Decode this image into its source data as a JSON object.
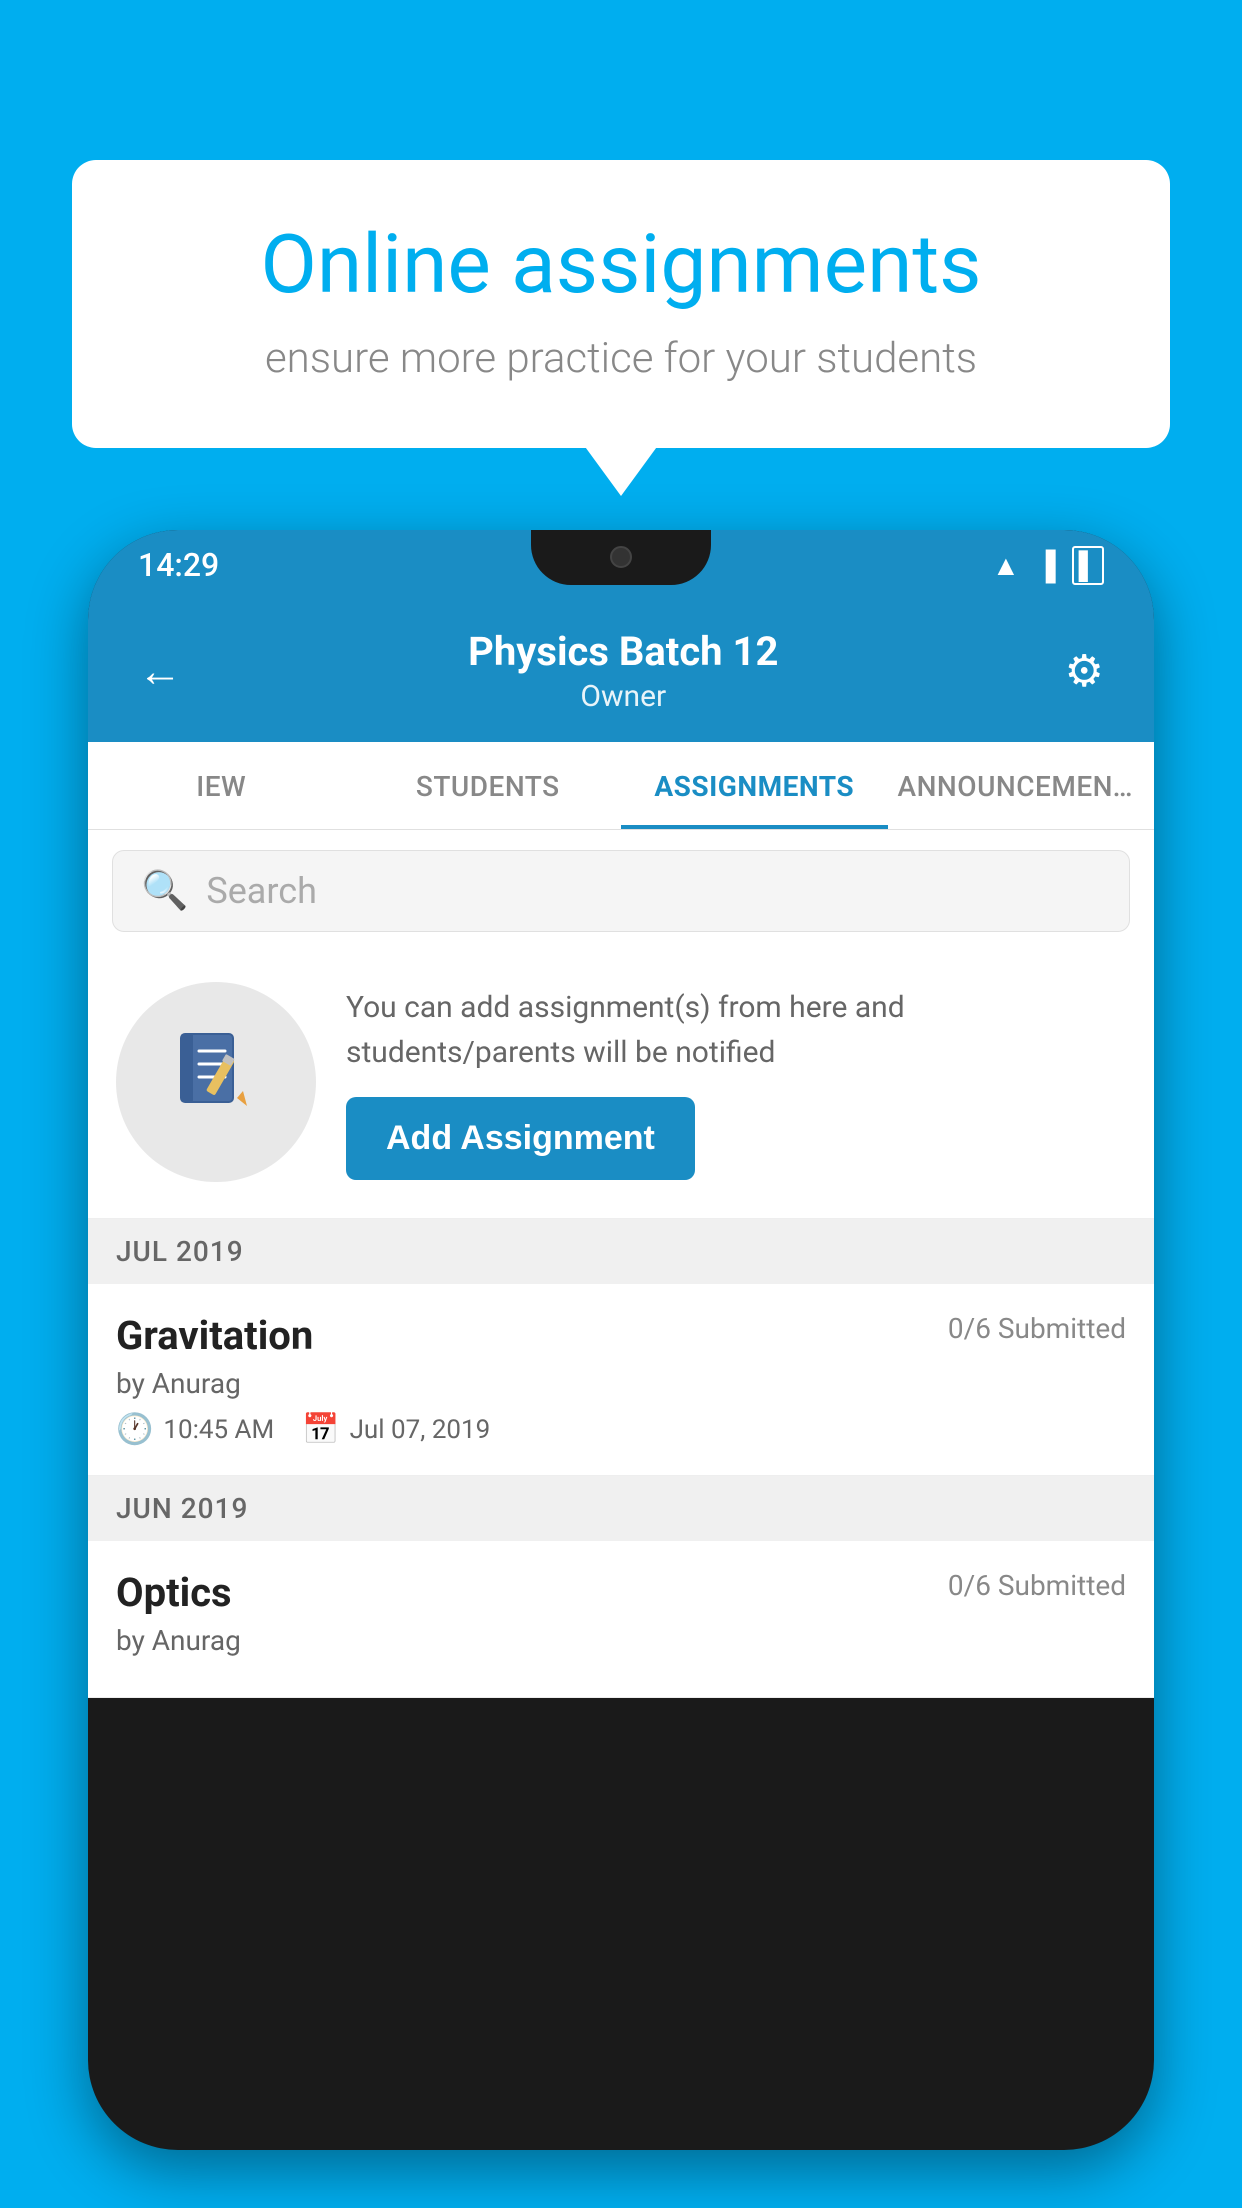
{
  "background_color": "#00AEEF",
  "speech_bubble": {
    "title": "Online assignments",
    "subtitle": "ensure more practice for your students"
  },
  "status_bar": {
    "time": "14:29",
    "icons": [
      "wifi",
      "signal",
      "battery"
    ]
  },
  "app_header": {
    "title": "Physics Batch 12",
    "subtitle": "Owner",
    "back_label": "←",
    "gear_label": "⚙"
  },
  "tabs": [
    {
      "label": "IEW",
      "active": false
    },
    {
      "label": "STUDENTS",
      "active": false
    },
    {
      "label": "ASSIGNMENTS",
      "active": true
    },
    {
      "label": "ANNOUNCEMENTS",
      "active": false
    }
  ],
  "search": {
    "placeholder": "Search"
  },
  "promo": {
    "description": "You can add assignment(s) from here and students/parents will be notified",
    "button_label": "Add Assignment"
  },
  "sections": [
    {
      "header": "JUL 2019",
      "assignments": [
        {
          "title": "Gravitation",
          "submitted": "0/6 Submitted",
          "author": "by Anurag",
          "time": "10:45 AM",
          "date": "Jul 07, 2019"
        }
      ]
    },
    {
      "header": "JUN 2019",
      "assignments": [
        {
          "title": "Optics",
          "submitted": "0/6 Submitted",
          "author": "by Anurag",
          "time": "",
          "date": ""
        }
      ]
    }
  ],
  "icons": {
    "notebook": "📓",
    "clock": "🕐",
    "calendar": "📅"
  }
}
